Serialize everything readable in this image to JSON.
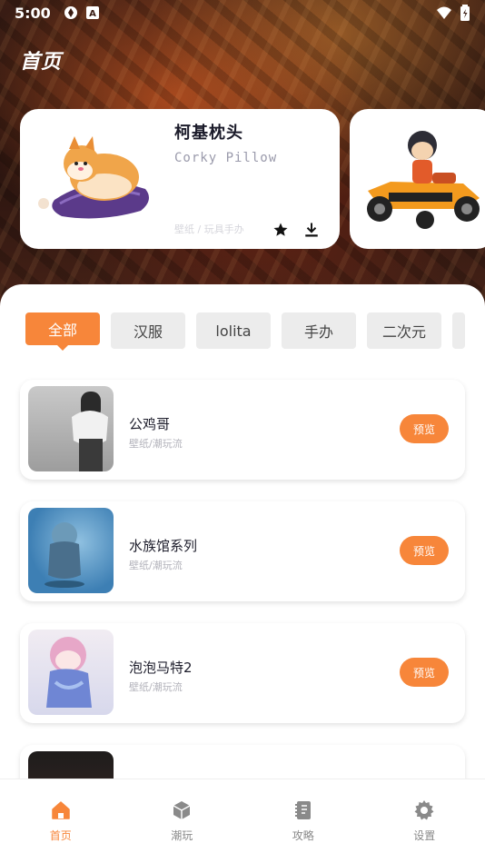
{
  "status_bar": {
    "time": "5:00"
  },
  "header": {
    "title": "首页"
  },
  "featured": [
    {
      "title": "柯基枕头",
      "subtitle": "Corky Pillow",
      "tags": "壁纸 / 玩具手办"
    },
    {
      "title": "",
      "subtitle": "",
      "tags": ""
    }
  ],
  "categories": [
    "全部",
    "汉服",
    "lolita",
    "手办",
    "二次元"
  ],
  "active_category": "全部",
  "items": [
    {
      "name": "公鸡哥",
      "sub": "壁纸/潮玩流",
      "button": "预览"
    },
    {
      "name": "水族馆系列",
      "sub": "壁纸/潮玩流",
      "button": "预览"
    },
    {
      "name": "泡泡马特2",
      "sub": "壁纸/潮玩流",
      "button": "预览"
    }
  ],
  "nav": [
    {
      "label": "首页",
      "icon": "home-icon",
      "active": true
    },
    {
      "label": "潮玩",
      "icon": "cube-icon",
      "active": false
    },
    {
      "label": "攻略",
      "icon": "notebook-icon",
      "active": false
    },
    {
      "label": "设置",
      "icon": "gear-icon",
      "active": false
    }
  ],
  "colors": {
    "accent": "#f7863a",
    "chip_bg": "#ececec",
    "hero_dark": "#2a140f"
  }
}
